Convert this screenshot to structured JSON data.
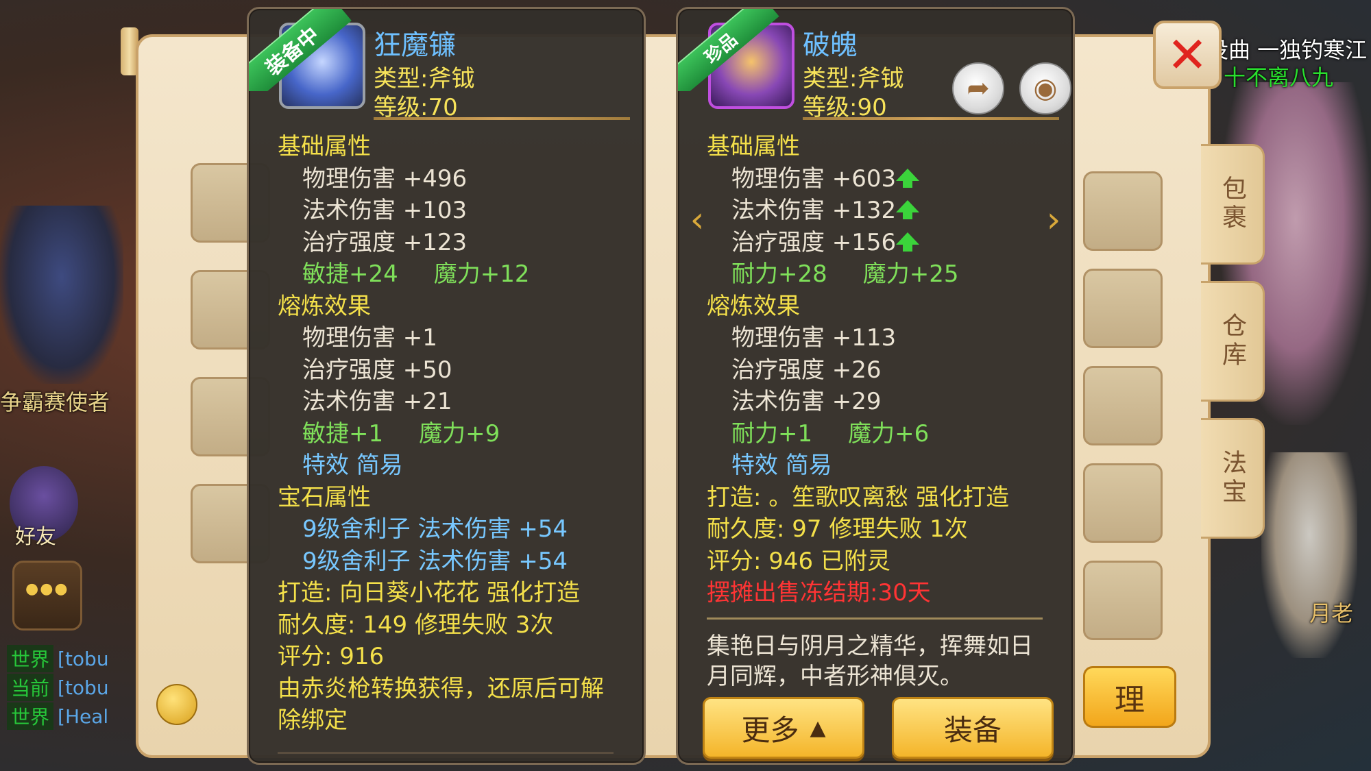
{
  "scene": {
    "npc_left": "争霸赛使者",
    "right_top_line1": "没曲 一独钓寒江",
    "right_top_line2": "十不离八九",
    "right_npc": "月老",
    "friend_label": "好友"
  },
  "chat": [
    {
      "channel": "世界",
      "text": "[tobu"
    },
    {
      "channel": "当前",
      "text": "[tobu"
    },
    {
      "channel": "世界",
      "text": "[Heal"
    }
  ],
  "inventory": {
    "tabs": [
      "包裹",
      "仓库",
      "法宝"
    ],
    "action_label": "理"
  },
  "equipped_item": {
    "badge": "装备中",
    "name": "狂魔镰",
    "type": "类型:斧钺",
    "level": "等级:70",
    "basic_title": "基础属性",
    "basic_stats": [
      "物理伤害 +496",
      "法术伤害 +103",
      "治疗强度 +123"
    ],
    "basic_bonus": [
      "敏捷+24",
      "魔力+12"
    ],
    "refine_title": "熔炼效果",
    "refine_stats": [
      "物理伤害 +1",
      "治疗强度 +50",
      "法术伤害 +21"
    ],
    "refine_bonus": [
      "敏捷+1",
      "魔力+9"
    ],
    "special": "特效 简易",
    "gem_title": "宝石属性",
    "gems": [
      "9级舍利子 法术伤害 +54",
      "9级舍利子 法术伤害 +54"
    ],
    "forge": "打造: 向日葵小花花 强化打造",
    "durability": "耐久度: 149 修理失败 3次",
    "score": "评分: 916",
    "note": "由赤炎枪转换获得，还原后可解除绑定"
  },
  "compared_item": {
    "badge": "珍品",
    "name": "破魄",
    "type": "类型:斧钺",
    "level": "等级:90",
    "basic_title": "基础属性",
    "basic_stats": [
      "物理伤害 +603",
      "法术伤害 +132",
      "治疗强度 +156"
    ],
    "basic_bonus": [
      "耐力+28",
      "魔力+25"
    ],
    "refine_title": "熔炼效果",
    "refine_stats": [
      "物理伤害 +113",
      "治疗强度 +26",
      "法术伤害 +29"
    ],
    "refine_bonus": [
      "耐力+1",
      "魔力+6"
    ],
    "special": "特效 简易",
    "forge": "打造: 。笙歌叹离愁 强化打造",
    "durability": "耐久度: 97 修理失败 1次",
    "score": "评分: 946 已附灵",
    "sale_notice": "摆摊出售冻结期:30天",
    "description": "集艳日与阴月之精华，挥舞如日月同辉，中者形神俱灭。",
    "more_button": "更多",
    "equip_button": "装备"
  },
  "icons": {
    "share": "share-icon",
    "view": "eye-icon",
    "close": "close-icon",
    "prev": "chevron-left-icon",
    "next": "chevron-right-icon",
    "upgrade": "green-up-arrow-icon"
  },
  "colors": {
    "stat_gold": "#f4e04a",
    "bonus_green": "#7fe05a",
    "gem_blue": "#78c8ff",
    "warning_red": "#ff3434",
    "card_bg": "#342f2a"
  }
}
